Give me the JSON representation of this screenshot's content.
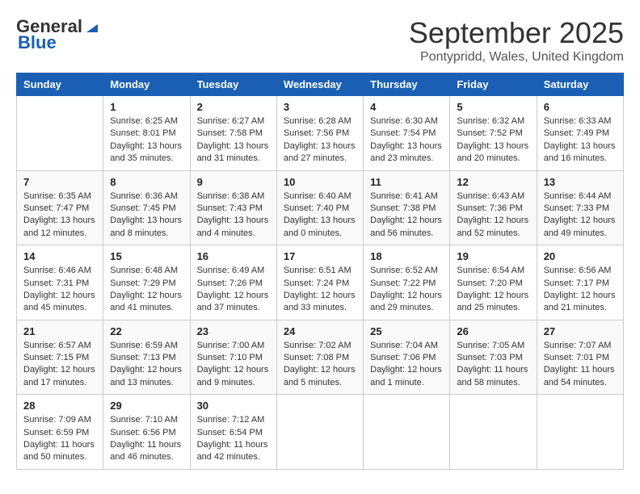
{
  "header": {
    "logo_general": "General",
    "logo_blue": "Blue",
    "month_title": "September 2025",
    "location": "Pontypridd, Wales, United Kingdom"
  },
  "calendar": {
    "days_of_week": [
      "Sunday",
      "Monday",
      "Tuesday",
      "Wednesday",
      "Thursday",
      "Friday",
      "Saturday"
    ],
    "weeks": [
      [
        {
          "day": "",
          "info": ""
        },
        {
          "day": "1",
          "info": "Sunrise: 6:25 AM\nSunset: 8:01 PM\nDaylight: 13 hours\nand 35 minutes."
        },
        {
          "day": "2",
          "info": "Sunrise: 6:27 AM\nSunset: 7:58 PM\nDaylight: 13 hours\nand 31 minutes."
        },
        {
          "day": "3",
          "info": "Sunrise: 6:28 AM\nSunset: 7:56 PM\nDaylight: 13 hours\nand 27 minutes."
        },
        {
          "day": "4",
          "info": "Sunrise: 6:30 AM\nSunset: 7:54 PM\nDaylight: 13 hours\nand 23 minutes."
        },
        {
          "day": "5",
          "info": "Sunrise: 6:32 AM\nSunset: 7:52 PM\nDaylight: 13 hours\nand 20 minutes."
        },
        {
          "day": "6",
          "info": "Sunrise: 6:33 AM\nSunset: 7:49 PM\nDaylight: 13 hours\nand 16 minutes."
        }
      ],
      [
        {
          "day": "7",
          "info": "Sunrise: 6:35 AM\nSunset: 7:47 PM\nDaylight: 13 hours\nand 12 minutes."
        },
        {
          "day": "8",
          "info": "Sunrise: 6:36 AM\nSunset: 7:45 PM\nDaylight: 13 hours\nand 8 minutes."
        },
        {
          "day": "9",
          "info": "Sunrise: 6:38 AM\nSunset: 7:43 PM\nDaylight: 13 hours\nand 4 minutes."
        },
        {
          "day": "10",
          "info": "Sunrise: 6:40 AM\nSunset: 7:40 PM\nDaylight: 13 hours\nand 0 minutes."
        },
        {
          "day": "11",
          "info": "Sunrise: 6:41 AM\nSunset: 7:38 PM\nDaylight: 12 hours\nand 56 minutes."
        },
        {
          "day": "12",
          "info": "Sunrise: 6:43 AM\nSunset: 7:36 PM\nDaylight: 12 hours\nand 52 minutes."
        },
        {
          "day": "13",
          "info": "Sunrise: 6:44 AM\nSunset: 7:33 PM\nDaylight: 12 hours\nand 49 minutes."
        }
      ],
      [
        {
          "day": "14",
          "info": "Sunrise: 6:46 AM\nSunset: 7:31 PM\nDaylight: 12 hours\nand 45 minutes."
        },
        {
          "day": "15",
          "info": "Sunrise: 6:48 AM\nSunset: 7:29 PM\nDaylight: 12 hours\nand 41 minutes."
        },
        {
          "day": "16",
          "info": "Sunrise: 6:49 AM\nSunset: 7:26 PM\nDaylight: 12 hours\nand 37 minutes."
        },
        {
          "day": "17",
          "info": "Sunrise: 6:51 AM\nSunset: 7:24 PM\nDaylight: 12 hours\nand 33 minutes."
        },
        {
          "day": "18",
          "info": "Sunrise: 6:52 AM\nSunset: 7:22 PM\nDaylight: 12 hours\nand 29 minutes."
        },
        {
          "day": "19",
          "info": "Sunrise: 6:54 AM\nSunset: 7:20 PM\nDaylight: 12 hours\nand 25 minutes."
        },
        {
          "day": "20",
          "info": "Sunrise: 6:56 AM\nSunset: 7:17 PM\nDaylight: 12 hours\nand 21 minutes."
        }
      ],
      [
        {
          "day": "21",
          "info": "Sunrise: 6:57 AM\nSunset: 7:15 PM\nDaylight: 12 hours\nand 17 minutes."
        },
        {
          "day": "22",
          "info": "Sunrise: 6:59 AM\nSunset: 7:13 PM\nDaylight: 12 hours\nand 13 minutes."
        },
        {
          "day": "23",
          "info": "Sunrise: 7:00 AM\nSunset: 7:10 PM\nDaylight: 12 hours\nand 9 minutes."
        },
        {
          "day": "24",
          "info": "Sunrise: 7:02 AM\nSunset: 7:08 PM\nDaylight: 12 hours\nand 5 minutes."
        },
        {
          "day": "25",
          "info": "Sunrise: 7:04 AM\nSunset: 7:06 PM\nDaylight: 12 hours\nand 1 minute."
        },
        {
          "day": "26",
          "info": "Sunrise: 7:05 AM\nSunset: 7:03 PM\nDaylight: 11 hours\nand 58 minutes."
        },
        {
          "day": "27",
          "info": "Sunrise: 7:07 AM\nSunset: 7:01 PM\nDaylight: 11 hours\nand 54 minutes."
        }
      ],
      [
        {
          "day": "28",
          "info": "Sunrise: 7:09 AM\nSunset: 6:59 PM\nDaylight: 11 hours\nand 50 minutes."
        },
        {
          "day": "29",
          "info": "Sunrise: 7:10 AM\nSunset: 6:56 PM\nDaylight: 11 hours\nand 46 minutes."
        },
        {
          "day": "30",
          "info": "Sunrise: 7:12 AM\nSunset: 6:54 PM\nDaylight: 11 hours\nand 42 minutes."
        },
        {
          "day": "",
          "info": ""
        },
        {
          "day": "",
          "info": ""
        },
        {
          "day": "",
          "info": ""
        },
        {
          "day": "",
          "info": ""
        }
      ]
    ]
  }
}
